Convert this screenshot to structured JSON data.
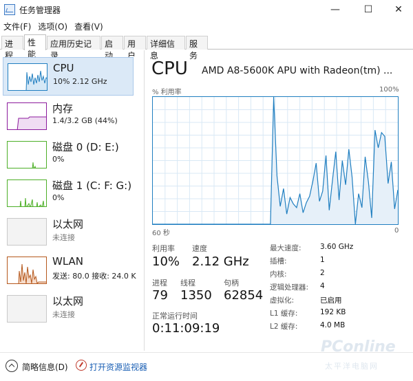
{
  "window": {
    "title": "任务管理器",
    "min_glyph": "—",
    "max_glyph": "☐",
    "close_glyph": "✕"
  },
  "menu": [
    "文件(F)",
    "选项(O)",
    "查看(V)"
  ],
  "tabs": [
    "进程",
    "性能",
    "应用历史记录",
    "启动",
    "用户",
    "详细信息",
    "服务"
  ],
  "active_tab": "性能",
  "resources": [
    {
      "name": "CPU",
      "sub": "10%  2.12 GHz",
      "color": "#1f7ec0",
      "selected": true
    },
    {
      "name": "内存",
      "sub": "1.4/3.2 GB (44%)",
      "color": "#8b1a9c"
    },
    {
      "name": "磁盘 0 (D: E:)",
      "sub": "0%",
      "color": "#4caf26"
    },
    {
      "name": "磁盘 1 (C: F: G:)",
      "sub": "0%",
      "color": "#4caf26"
    },
    {
      "name": "以太网",
      "sub": "未连接",
      "color": "#999999"
    },
    {
      "name": "WLAN",
      "sub": "发送: 80.0  接收: 24.0 K",
      "color": "#b5571b"
    },
    {
      "name": "以太网",
      "sub": "未连接",
      "color": "#999999"
    }
  ],
  "cpu": {
    "heading": "CPU",
    "model": "AMD A8-5600K APU with Radeon(tm) ...",
    "graph_label_left": "% 利用率",
    "graph_label_right": "100%",
    "axis_left": "60 秒",
    "axis_right": "0",
    "usage_history": [
      0,
      0,
      0,
      0,
      0,
      0,
      0,
      0,
      0,
      0,
      0,
      0,
      0,
      0,
      0,
      0,
      0,
      0,
      0,
      0,
      0,
      0,
      0,
      0,
      0,
      0,
      0,
      0,
      0,
      0,
      0,
      0,
      0,
      0,
      0,
      0,
      0,
      100,
      38,
      14,
      28,
      8,
      21,
      16,
      13,
      24,
      9,
      17,
      22,
      34,
      48,
      18,
      26,
      54,
      11,
      35,
      57,
      19,
      50,
      31,
      59,
      37,
      0,
      24,
      13,
      53,
      33,
      5,
      74,
      60,
      72,
      69,
      32,
      49,
      12,
      27
    ],
    "utilization_label": "利用率",
    "utilization_value": "10%",
    "speed_label": "速度",
    "speed_value": "2.12 GHz",
    "processes_label": "进程",
    "processes_value": "79",
    "threads_label": "线程",
    "threads_value": "1350",
    "handles_label": "句柄",
    "handles_value": "62854",
    "uptime_label": "正常运行时间",
    "uptime_value": "0:11:09:19",
    "specs": [
      {
        "label": "最大速度:",
        "value": "3.60 GHz"
      },
      {
        "label": "插槽:",
        "value": "1"
      },
      {
        "label": "内核:",
        "value": "2"
      },
      {
        "label": "逻辑处理器:",
        "value": "4"
      },
      {
        "label": "虚拟化:",
        "value": "已启用"
      },
      {
        "label": "L1 缓存:",
        "value": "192 KB"
      },
      {
        "label": "L2 缓存:",
        "value": "4.0 MB"
      }
    ]
  },
  "footer": {
    "summary": "简略信息(D)",
    "monitor_link": "打开资源监视器"
  },
  "watermark": {
    "main": "PConline",
    "sub": "太平洋电脑网"
  }
}
